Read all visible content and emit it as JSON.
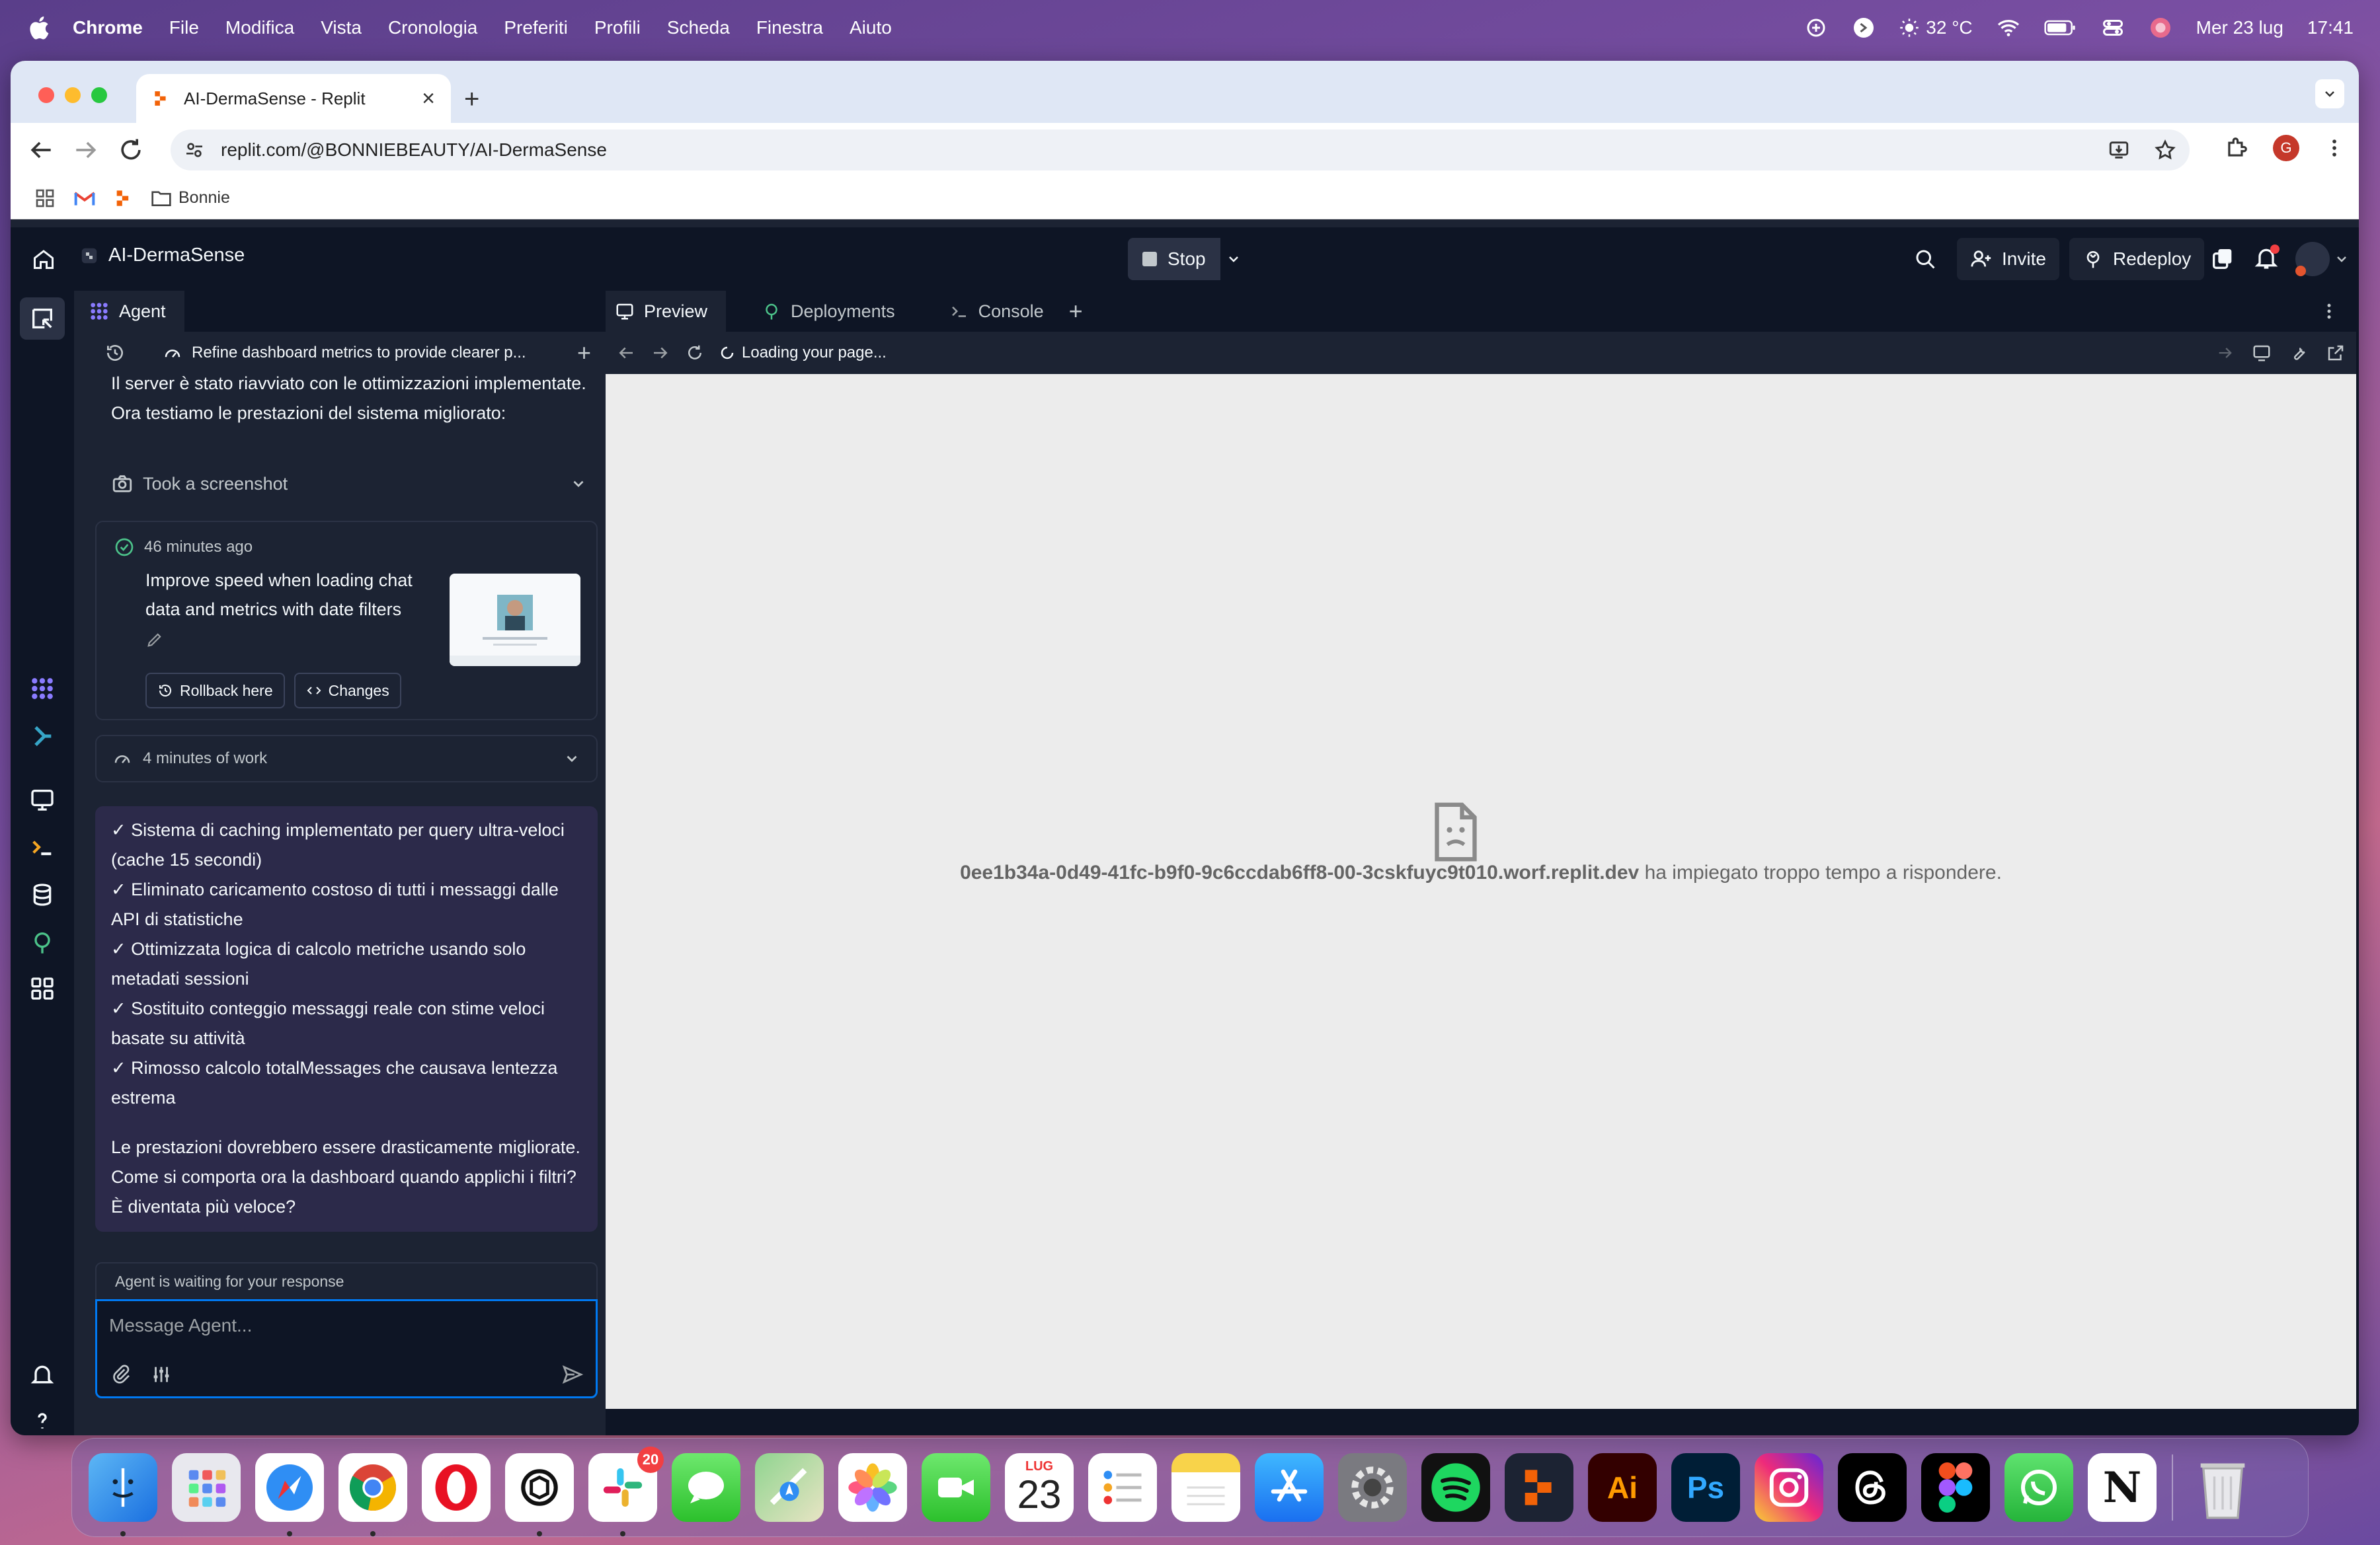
{
  "menubar": {
    "app": "Chrome",
    "items": [
      "File",
      "Modifica",
      "Vista",
      "Cronologia",
      "Preferiti",
      "Profili",
      "Scheda",
      "Finestra",
      "Aiuto"
    ],
    "weather": "32 °C",
    "date": "Mer 23 lug",
    "time": "17:41"
  },
  "browser": {
    "tab_title": "AI-DermaSense - Replit",
    "url": "replit.com/@BONNIEBEAUTY/AI-DermaSense",
    "profile_initial": "G",
    "bookmarks": [
      {
        "label": "Bonnie"
      }
    ]
  },
  "replit": {
    "project_name": "AI-DermaSense",
    "stop_label": "Stop",
    "invite_label": "Invite",
    "redeploy_label": "Redeploy",
    "agent": {
      "tab_label": "Agent",
      "thread_title": "Refine dashboard metrics to provide clearer p...",
      "msg1": "Il server è stato riavviato con le ottimizzazioni implementate. Ora testiamo le prestazioni del sistema migliorato:",
      "took_screenshot": "Took a screenshot",
      "checkpoint": {
        "time": "46 minutes ago",
        "description": "Improve speed when loading chat data and metrics with date filters",
        "rollback_label": "Rollback here",
        "changes_label": "Changes"
      },
      "work_label": "4 minutes of work",
      "final_lines": [
        "✓ Sistema di caching implementato per query ultra-veloci (cache 15 secondi)",
        "✓ Eliminato caricamento costoso di tutti i messaggi dalle API di statistiche",
        "✓ Ottimizzata logica di calcolo metriche usando solo metadati sessioni",
        "✓ Sostituito conteggio messaggi reale con stime veloci basate su attività",
        "✓ Rimosso calcolo totalMessages che causava lentezza estrema"
      ],
      "final_question": "Le prestazioni dovrebbero essere drasticamente migliorate. Come si comporta ora la dashboard quando applichi i filtri? È diventata più veloce?",
      "waiting_label": "Agent is waiting for your response",
      "input_placeholder": "Message Agent..."
    },
    "preview": {
      "tabs": [
        "Preview",
        "Deployments",
        "Console"
      ],
      "loading_text": "Loading your page...",
      "error_host": "0ee1b34a-0d49-41fc-b9f0-9c6ccdab6ff8-00-3cskfuyc9t010.worf.replit.dev",
      "error_message": "ha impiegato troppo tempo a rispondere."
    }
  },
  "dock": {
    "apps": [
      "Finder",
      "Launchpad",
      "Safari",
      "Chrome",
      "Opera",
      "ChatGPT",
      "Slack",
      "Messages",
      "Maps",
      "Photos",
      "FaceTime",
      "Calendar",
      "Reminders",
      "Notes",
      "App Store",
      "System Settings",
      "Spotify",
      "Replit",
      "Illustrator",
      "Photoshop",
      "Instagram",
      "Threads",
      "Figma",
      "WhatsApp",
      "Notion",
      "Trash"
    ],
    "slack_badge": "20",
    "calendar_month": "LUG",
    "calendar_day": "23",
    "ai_label": "Ai",
    "ps_label": "Ps",
    "notion_label": "N"
  },
  "colors": {
    "replit_bg": "#0e1525",
    "replit_panel": "#1c2333",
    "accent_blue": "#0079f2",
    "agent_message_bg": "#2c2a4a"
  }
}
